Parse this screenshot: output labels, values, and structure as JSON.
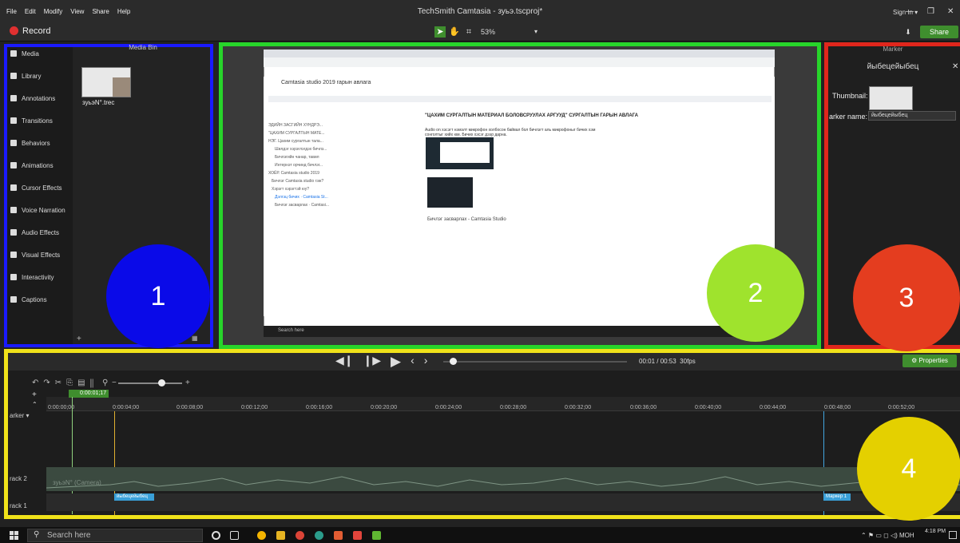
{
  "menu": [
    "File",
    "Edit",
    "Modify",
    "View",
    "Share",
    "Help"
  ],
  "app_title": "TechSmith Camtasia - зуьэ.tscproj*",
  "sign_in": "Sign In ▾",
  "record_label": "Record",
  "zoom_level": "53%",
  "share_label": "Share",
  "sidebar": [
    {
      "label": "Media",
      "icon": "media-icon"
    },
    {
      "label": "Library",
      "icon": "library-icon"
    },
    {
      "label": "Annotations",
      "icon": "annotations-icon"
    },
    {
      "label": "Transitions",
      "icon": "transitions-icon"
    },
    {
      "label": "Behaviors",
      "icon": "behaviors-icon"
    },
    {
      "label": "Animations",
      "icon": "animations-icon"
    },
    {
      "label": "Cursor Effects",
      "icon": "cursor-effects-icon"
    },
    {
      "label": "Voice Narration",
      "icon": "voice-narration-icon"
    },
    {
      "label": "Audio Effects",
      "icon": "audio-effects-icon"
    },
    {
      "label": "Visual Effects",
      "icon": "visual-effects-icon"
    },
    {
      "label": "Interactivity",
      "icon": "interactivity-icon"
    },
    {
      "label": "Captions",
      "icon": "captions-icon"
    }
  ],
  "media_bin": {
    "header": "Media Bin",
    "item_name": "зуьэN°.trec"
  },
  "canvas": {
    "doc_title": "Camtasia studio 2019 гарын авлага",
    "doc_heading": "\"ЦАХИМ СУРГАЛТЫН МАТЕРИАЛ БОЛОВСРУУЛАХ АРГУУД\" СУРГАЛТЫН ГАРЫН АВЛАГА",
    "doc_para": "Audio on хэсэгт нэмэлт микрофон холбосон байвал бол бичлэгт аль микрофоныг бичих хэм сонголтыг хийх юм. Бичих хэсэг дээр дарна.",
    "outline": [
      "ЭДИЙН ЗАСГИЙН ХҮНДРЭ...",
      "\"ЦАХИМ СУРГАЛТЫН МАТЕ...",
      "НЭГ. Цахим сургалтын тала...",
      "Шилдэг хэрэглэгдэх бичлэ...",
      "Бичлэгийн чанар, тавил",
      "Интернэт орчинд бичлэг...",
      "ХОЁР. Camtasia studio 2019",
      "Бичлэг Camtasia studio гэж?",
      "Хэрэгт хэрэгтэй юу?",
      "Дэлгэц бичих · Camtasia St...",
      "Бичлэг засварлах · Camtasi..."
    ],
    "caption": "Бичлэг засварлах - Camtasia Studio",
    "inner_taskbar_search": "Search here"
  },
  "properties_panel": {
    "header": "Marker",
    "title": "йыбецейыбец",
    "thumbnail_label": "Thumbnail:",
    "marker_name_label": "arker name:",
    "marker_name_value": "йыбецейыбец"
  },
  "playback": {
    "timecode": "00:01 / 00:53",
    "fps": "30fps",
    "properties_label": "Properties"
  },
  "timeline": {
    "playhead_time": "0:00:01;17",
    "ticks": [
      "0:00:00;00",
      "0:00:04;00",
      "0:00:08;00",
      "0:00:12;00",
      "0:00:16;00",
      "0:00:20;00",
      "0:00:24;00",
      "0:00:28;00",
      "0:00:32;00",
      "0:00:36;00",
      "0:00:40;00",
      "0:00:44;00",
      "0:00:48;00",
      "0:00:52;00"
    ],
    "marker_row_label": "arker ▾",
    "track2_label": "rack 2",
    "track1_label": "rack 1",
    "track2_clip": "зуьэN° (Camera)",
    "marker1": "йыбецейыбец",
    "marker2": "Маркер 1"
  },
  "callouts": [
    "1",
    "2",
    "3",
    "4"
  ],
  "taskbar": {
    "search": "Search here",
    "time": "4:18 PM",
    "lang": "МОН"
  },
  "colors": {
    "accent_green": "#3f8e2e",
    "record_red": "#e03030",
    "callout1": "#0a0ae8",
    "callout2": "#9fe32d",
    "callout3": "#e43d1f",
    "callout4": "#e4d000"
  }
}
